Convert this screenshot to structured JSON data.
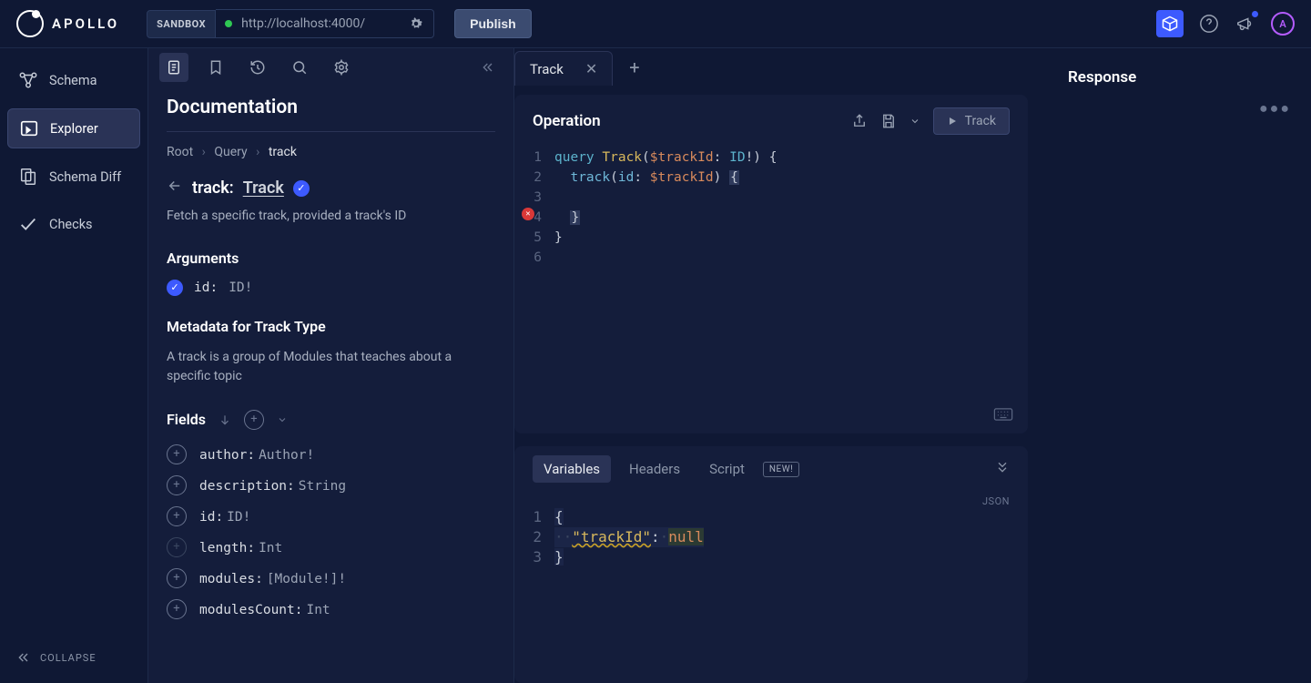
{
  "brand": {
    "name": "APOLLO"
  },
  "topbar": {
    "sandbox_label": "SANDBOX",
    "url": "http://localhost:4000/",
    "publish_label": "Publish",
    "avatar_initial": "A"
  },
  "sidebar": {
    "items": [
      {
        "label": "Schema"
      },
      {
        "label": "Explorer"
      },
      {
        "label": "Schema Diff"
      },
      {
        "label": "Checks"
      }
    ],
    "collapse_label": "COLLAPSE"
  },
  "documentation": {
    "title": "Documentation",
    "breadcrumb": {
      "root": "Root",
      "query": "Query",
      "current": "track"
    },
    "type": {
      "field": "track:",
      "name": "Track"
    },
    "description": "Fetch a specific track, provided a track's ID",
    "arguments": {
      "heading": "Arguments",
      "items": [
        {
          "name": "id:",
          "type": "ID!"
        }
      ]
    },
    "metadata": {
      "heading": "Metadata for Track Type",
      "description": "A track is a group of Modules that teaches about a specific topic"
    },
    "fields": {
      "heading": "Fields",
      "items": [
        {
          "name": "author:",
          "type": "Author!"
        },
        {
          "name": "description:",
          "type": "String"
        },
        {
          "name": "id:",
          "type": "ID!"
        },
        {
          "name": "length:",
          "type": "Int",
          "disabled": true
        },
        {
          "name": "modules:",
          "type": "[Module!]!"
        },
        {
          "name": "modulesCount:",
          "type": "Int"
        }
      ]
    }
  },
  "tabs": {
    "active": "Track"
  },
  "operation": {
    "title": "Operation",
    "run_label": "Track",
    "gutter": [
      "1",
      "2",
      "3",
      "4",
      "5",
      "6"
    ],
    "error_line": 4,
    "tokens": {
      "l1_kw": "query",
      "l1_name": "Track",
      "l1_var": "$trackId",
      "l1_type": "ID",
      "l1_bang": "!",
      "l2_field": "track",
      "l2_arg": "id",
      "l2_var": "$trackId"
    }
  },
  "variables": {
    "tabs": {
      "variables": "Variables",
      "headers": "Headers",
      "script": "Script",
      "new_badge": "NEW!"
    },
    "json_label": "JSON",
    "gutter": [
      "1",
      "2",
      "3"
    ],
    "tokens": {
      "key": "\"trackId\"",
      "value": "null"
    }
  },
  "response": {
    "title": "Response"
  }
}
